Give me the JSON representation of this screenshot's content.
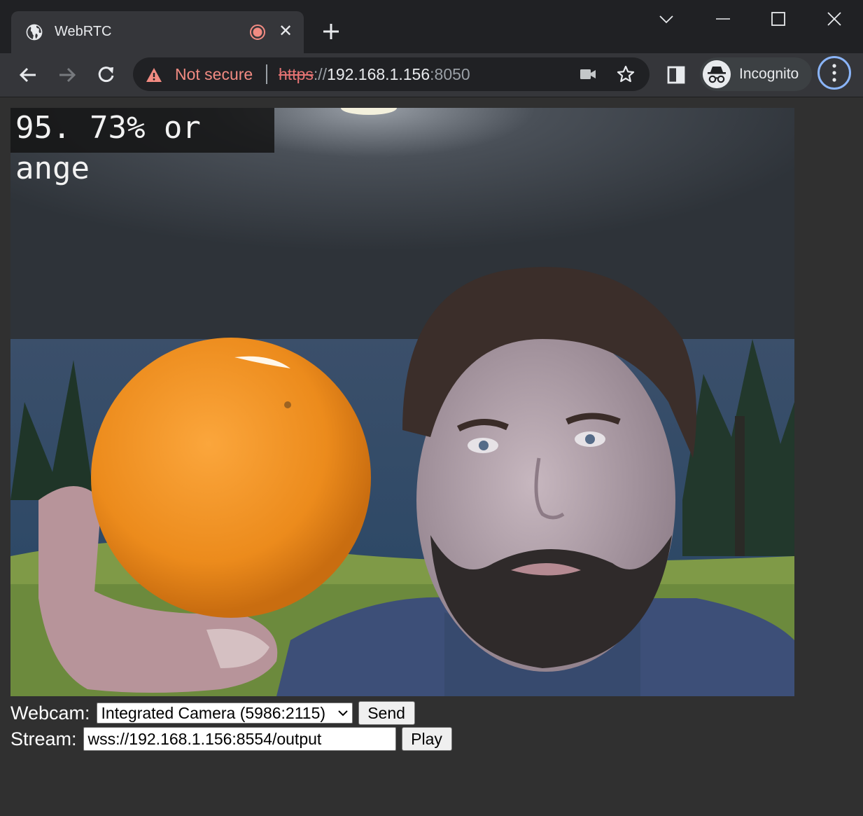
{
  "tab": {
    "title": "WebRTC",
    "close_glyph": "✕"
  },
  "omnibox": {
    "security_label": "Not secure",
    "url_scheme": "https",
    "url_slashes": "://",
    "url_host": "192.168.1.156",
    "url_port": ":8050"
  },
  "profile": {
    "label": "Incognito"
  },
  "video": {
    "overlay_text": "95. 73% or ange"
  },
  "controls": {
    "webcam_label": "Webcam:",
    "webcam_selected": "Integrated Camera (5986:2115)",
    "send_label": "Send",
    "stream_label": "Stream:",
    "stream_value": "wss://192.168.1.156:8554/output",
    "play_label": "Play"
  },
  "colors": {
    "titlebar": "#202124",
    "toolbar": "#35363a",
    "page_bg": "#303030",
    "warning": "#f28b82",
    "focus_ring": "#8ab4f8"
  }
}
